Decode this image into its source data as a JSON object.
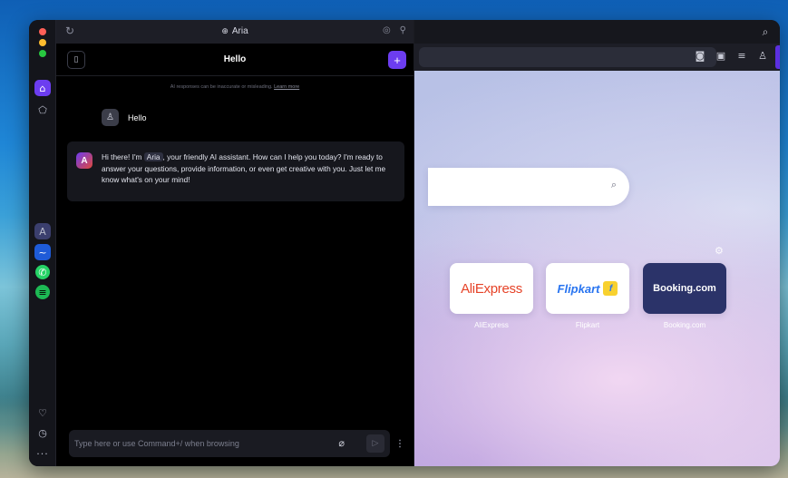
{
  "aria": {
    "window_title": "Aria",
    "chat_title": "Hello",
    "disclaimer": "AI responses can be inaccurate or misleading.",
    "learn_more": "Learn more",
    "user_message": "Hello",
    "reply_before": "Hi there! I'm ",
    "reply_name": "Aria",
    "reply_after": ", your friendly AI assistant. How can I help you today? I'm ready to answer your questions, provide information, or even get creative with you. Just let me know what's on your mind!",
    "input_placeholder": "Type here or use Command+/ when browsing",
    "input_value": ""
  },
  "speed_dials": [
    {
      "name": "AliExpress",
      "label": "AliExpress"
    },
    {
      "name": "Flipkart",
      "label": "Flipkart"
    },
    {
      "name": "Booking.com",
      "label": "Booking.com"
    }
  ],
  "icons": {
    "home": "home-icon",
    "bookmarks": "bookmarks-icon",
    "aria": "aria-icon",
    "messenger": "messenger-icon",
    "whatsapp": "whatsapp-icon",
    "spotify": "spotify-icon",
    "heart": "heart-icon",
    "history": "history-icon",
    "more": "more-icon"
  },
  "colors": {
    "accent": "#6c3df0",
    "aliexpress": "#e64328",
    "flipkart": "#2874f0",
    "booking_bg": "#2b3369"
  }
}
